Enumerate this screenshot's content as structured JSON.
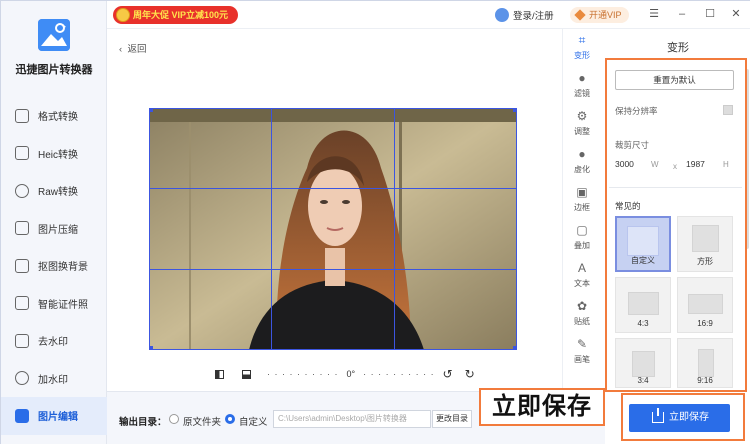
{
  "app": {
    "name": "迅捷图片转换器"
  },
  "topbar": {
    "promo": "周年大促 VIP立减100元",
    "login": "登录/注册",
    "vip": "开通VIP",
    "menu_icon": "menu-icon",
    "min_icon": "minimize-icon",
    "max_icon": "maximize-icon",
    "close_icon": "close-icon"
  },
  "sidebar": {
    "items": [
      {
        "label": "格式转换",
        "icon": "convert-icon"
      },
      {
        "label": "Heic转换",
        "icon": "heic-icon"
      },
      {
        "label": "Raw转换",
        "icon": "raw-icon"
      },
      {
        "label": "图片压缩",
        "icon": "compress-icon"
      },
      {
        "label": "抠图换背景",
        "icon": "cutout-icon"
      },
      {
        "label": "智能证件照",
        "icon": "id-photo-icon"
      },
      {
        "label": "去水印",
        "icon": "remove-watermark-icon"
      },
      {
        "label": "加水印",
        "icon": "add-watermark-icon"
      },
      {
        "label": "图片编辑",
        "icon": "edit-icon",
        "active": true
      }
    ]
  },
  "workspace": {
    "back": "返回",
    "rotation": "0°"
  },
  "bottombar": {
    "output_label": "输出目录：",
    "option_original": "原文件夹",
    "option_custom": "自定义",
    "path": "C:\\Users\\admin\\Desktop\\图片转换器",
    "change_dir": "更改目录"
  },
  "tools": [
    {
      "label": "变形",
      "icon": "crop-icon",
      "active": true
    },
    {
      "label": "滤镜",
      "icon": "filter-icon"
    },
    {
      "label": "调整",
      "icon": "adjust-icon"
    },
    {
      "label": "虚化",
      "icon": "blur-icon"
    },
    {
      "label": "边框",
      "icon": "border-icon"
    },
    {
      "label": "叠加",
      "icon": "overlay-icon"
    },
    {
      "label": "文本",
      "icon": "text-icon"
    },
    {
      "label": "贴纸",
      "icon": "sticker-icon"
    },
    {
      "label": "画笔",
      "icon": "brush-icon"
    }
  ],
  "panel": {
    "title": "变形",
    "reset": "重置为默认",
    "keep_resolution": "保持分辨率",
    "crop_size": "裁剪尺寸",
    "width": "3000",
    "width_unit": "W",
    "times": "x",
    "height": "1987",
    "height_unit": "H",
    "common": "常见的",
    "presets": [
      {
        "label": "自定义",
        "selected": true
      },
      {
        "label": "方形"
      },
      {
        "label": "4:3"
      },
      {
        "label": "16:9"
      },
      {
        "label": "3:4"
      },
      {
        "label": "9:16"
      }
    ]
  },
  "save": {
    "button": "立即保存",
    "callout": "立即保存"
  },
  "colors": {
    "accent": "#2a6de8",
    "highlight": "#f27b3c",
    "grid": "#3c55e0"
  }
}
